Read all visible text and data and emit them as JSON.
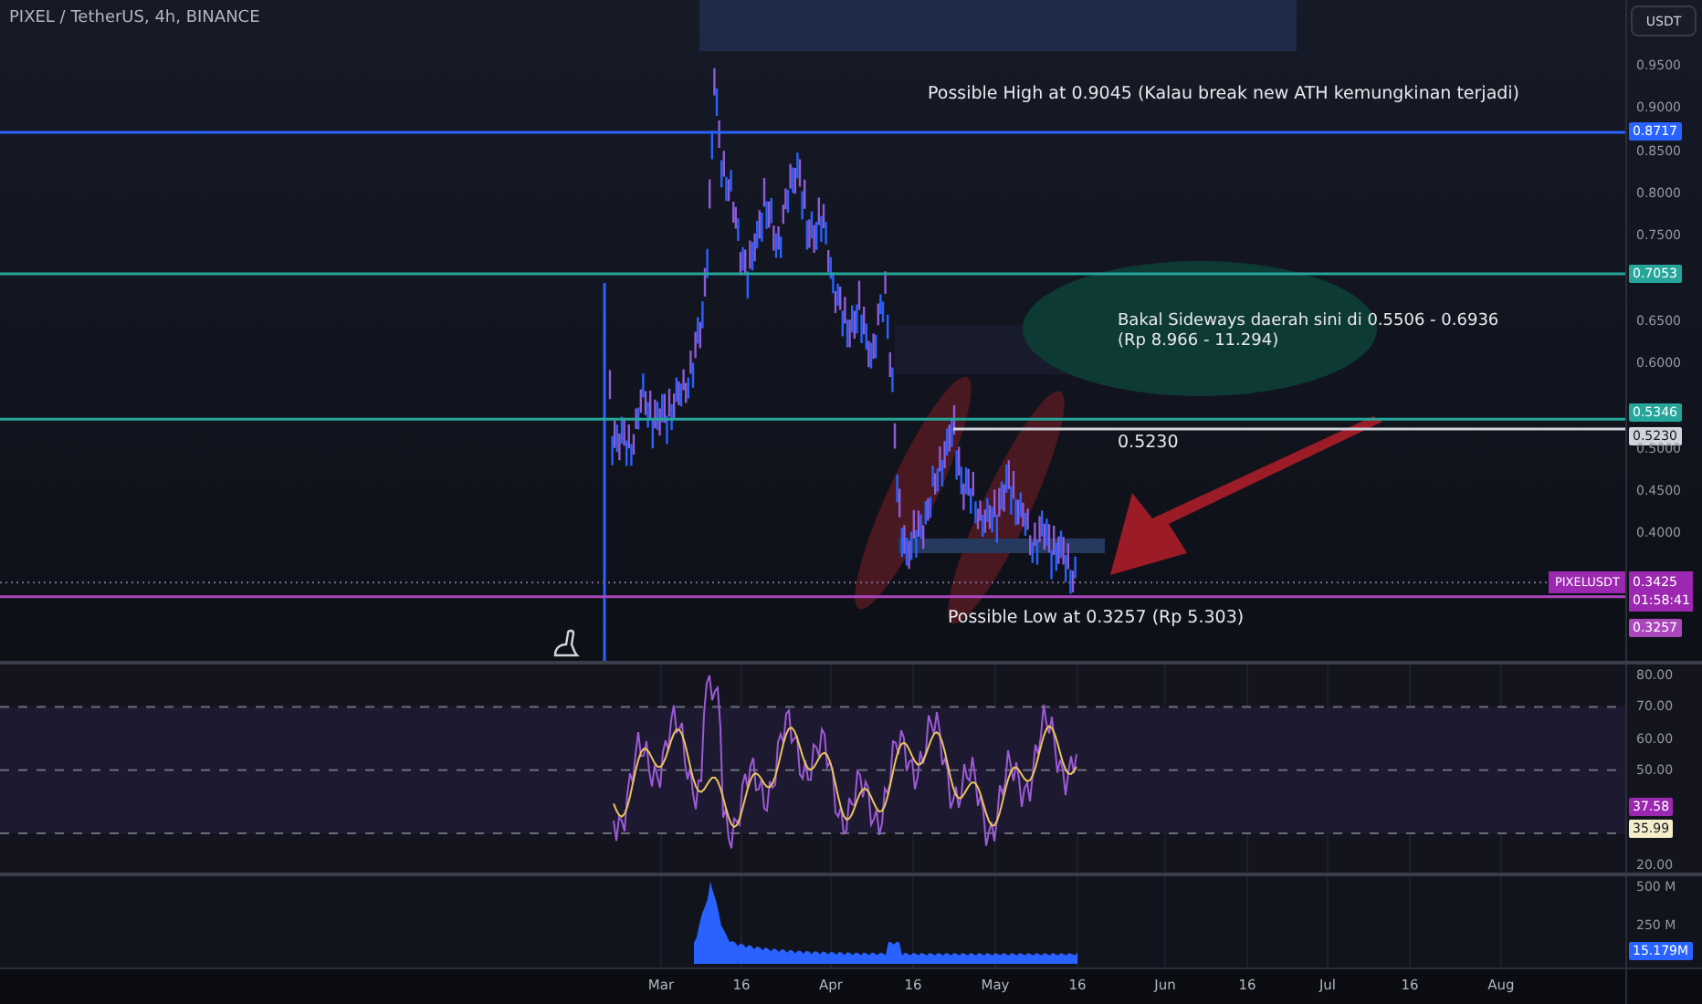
{
  "header": {
    "title": "PIXEL / TetherUS, 4h, BINANCE"
  },
  "currency_button": "USDT",
  "price_ticks": [
    "0.9500",
    "0.9000",
    "0.8500",
    "0.8000",
    "0.7500",
    "0.6500",
    "0.6000",
    "0.5000",
    "0.4500",
    "0.4000"
  ],
  "price_levels": [
    {
      "kind": "line",
      "price": "0.8717",
      "color": "#2962ff"
    },
    {
      "kind": "line",
      "price": "0.7053",
      "color": "#26a69a"
    },
    {
      "kind": "line",
      "price": "0.5346",
      "color": "#26a69a"
    },
    {
      "kind": "ray",
      "price": "0.5230",
      "color": "#d1d4dc"
    },
    {
      "kind": "line",
      "price": "0.3257",
      "color": "#ab47bc"
    }
  ],
  "last_price": {
    "symbol": "PIXELUSDT",
    "price": "0.3425",
    "countdown": "01:58:41"
  },
  "annotations": [
    {
      "kind": "high_note",
      "text": "Possible High at 0.9045 (Kalau break new ATH kemungkinan terjadi)"
    },
    {
      "kind": "range_note",
      "text": "Bakal Sideways daerah sini di 0.5506 - 0.6936\n(Rp 8.966 - 11.294)"
    },
    {
      "kind": "level_note",
      "text": "0.5230"
    },
    {
      "kind": "low_note",
      "text": "Possible Low at 0.3257 (Rp 5.303)"
    }
  ],
  "rsi": {
    "ticks": [
      "80.00",
      "70.00",
      "60.00",
      "50.00",
      "20.00"
    ],
    "values": [
      {
        "value": "37.58",
        "color": "#9c27b0"
      },
      {
        "value": "35.99",
        "color": "#f5ecc9"
      }
    ]
  },
  "volume": {
    "ticks": [
      "500 M",
      "250 M"
    ],
    "value": "15.179M"
  },
  "time_axis": [
    "Mar",
    "16",
    "Apr",
    "16",
    "May",
    "16",
    "Jun",
    "16",
    "Jul",
    "16",
    "Aug"
  ]
}
